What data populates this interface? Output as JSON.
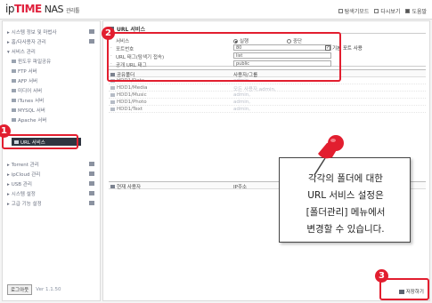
{
  "header": {
    "logo_ip": "ip",
    "logo_time": "TIME",
    "logo_nas": "NAS",
    "logo_mgr": "관리툴",
    "links": [
      "탐색기모드",
      "다시보기",
      "도움말"
    ]
  },
  "sidebar": {
    "items": [
      {
        "label": "시스템 정보 및 마법사"
      },
      {
        "label": "홈/다사용자 관리"
      },
      {
        "label": "서비스 관리"
      }
    ],
    "sub_items": [
      {
        "label": "윈도우 파일공유"
      },
      {
        "label": "FTP 서버"
      },
      {
        "label": "AFP 서버"
      },
      {
        "label": "미디어 서버"
      },
      {
        "label": "iTunes 서버"
      },
      {
        "label": "MYSQL 서버"
      },
      {
        "label": "Apache 서버"
      }
    ],
    "active_item": "URL 서비스",
    "lower_items": [
      {
        "label": "Torrent 관리"
      },
      {
        "label": "ipCloud 관리"
      },
      {
        "label": "USB 관리"
      },
      {
        "label": "시스템 설정"
      },
      {
        "label": "고급 기능 설정"
      }
    ],
    "close_label": "로그아웃",
    "version": "Ver 1.1.50"
  },
  "main": {
    "section_title": "URL 서비스",
    "form": {
      "service_label": "서비스",
      "radio_on": "실행",
      "radio_off": "중단",
      "port_label": "포트번호",
      "port_value": "80",
      "default_port_label": "기본 포트 사용",
      "tag_label": "URL 태그(탐색기 접속)",
      "tag_value": "list",
      "public_tag_label": "공개 URL 태그",
      "public_tag_value": "public"
    },
    "folders": {
      "col1": "공유폴더",
      "col2": "사용자/그룹",
      "rows": [
        {
          "name": "HDD1/Data",
          "user": "admin,"
        },
        {
          "name": "HDD1/Media",
          "user": "모든 사용자,admin,"
        },
        {
          "name": "HDD1/Music",
          "user": "admin,"
        },
        {
          "name": "HDD1/Photo",
          "user": "admin,"
        },
        {
          "name": "HDD1/Text",
          "user": "admin,"
        }
      ]
    },
    "users": {
      "col1": "현재 사용자",
      "col2": "IP주소"
    },
    "save_label": "저장하기"
  },
  "callout": {
    "lines": [
      "각각의 폴더에 대한",
      "URL 서비스 설정은",
      "[폴더관리] 메뉴에서",
      "변경할 수 있습니다."
    ]
  },
  "badges": [
    "1",
    "2",
    "3"
  ],
  "colors": {
    "brand_red": "#e21e2f",
    "active_bg": "#2f3540"
  }
}
